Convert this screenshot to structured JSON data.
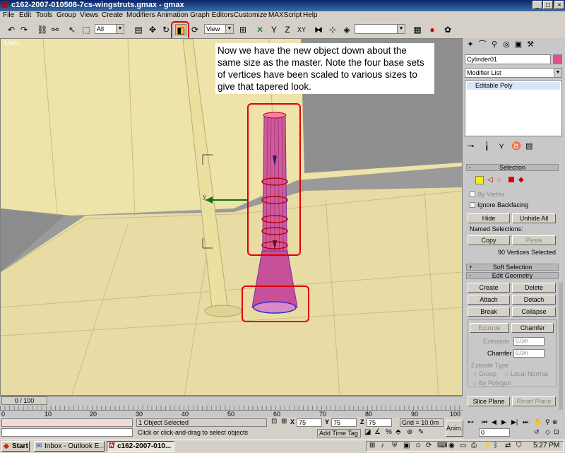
{
  "window": {
    "title": "c162-2007-010508-7cs-wingstruts.gmax - gmax",
    "minimize": "_",
    "maximize": "□",
    "close": "×"
  },
  "menu": [
    "File",
    "Edit",
    "Tools",
    "Group",
    "Views",
    "Create",
    "Modifiers",
    "Animation",
    "Graph Editors",
    "Customize",
    "MAXScript",
    "Help"
  ],
  "toolbar": {
    "selection_filter": "All",
    "reference_coord": "View",
    "named_selection": ""
  },
  "viewport": {
    "label": "User",
    "axis_label": "y"
  },
  "annotation": {
    "text": "Now we have the new object down about the same size as the master.  Note the four base sets of vertices have been scaled to various sizes to give that tapered look."
  },
  "command_panel": {
    "object_name": "Cylinder01",
    "object_color": "#e0508c",
    "modifier_list": "Modifier List",
    "stack_item": "Editable Poly",
    "selection": {
      "title": "Selection",
      "by_vertex": "By Vertex",
      "ignore_backfacing": "Ignore Backfacing",
      "hide": "Hide",
      "unhide_all": "Unhide All",
      "named_selections": "Named Selections:",
      "copy": "Copy",
      "paste": "Paste",
      "status": "90 Vertices Selected"
    },
    "soft_selection": "Soft Selection",
    "edit_geometry": {
      "title": "Edit Geometry",
      "create": "Create",
      "delete": "Delete",
      "attach": "Attach",
      "detach": "Detach",
      "break": "Break",
      "collapse": "Collapse",
      "extrude": "Extrude",
      "chamfer": "Chamfer",
      "extrusion": "Extrusion",
      "extrusion_value": "0.0m",
      "chamfer_label": "Chamfer",
      "chamfer_value": "0.0m",
      "extrude_type": "Extrude Type",
      "group": "Group",
      "local_normal": "Local Normal",
      "by_polygon": "By Polygon",
      "slice_plane": "Slice Plane",
      "reset_plane": "Reset Plane"
    }
  },
  "timeline": {
    "frame": "0 / 100",
    "ticks": [
      "0",
      "10",
      "20",
      "30",
      "40",
      "50",
      "60",
      "70",
      "80",
      "90",
      "100"
    ]
  },
  "status": {
    "selected": "1 Object Selected",
    "prompt": "Click or click-and-drag to select objects",
    "x": "75",
    "y": "75",
    "z": "75",
    "grid": "Grid = 10.0m",
    "add_time_tag": "Add Time Tag",
    "anim": "Anim.",
    "frame_field": "0"
  },
  "taskbar": {
    "start": "Start",
    "tasks": [
      "Inbox - Outlook E...",
      "c162-2007-010..."
    ],
    "clock": "5:27 PM"
  }
}
